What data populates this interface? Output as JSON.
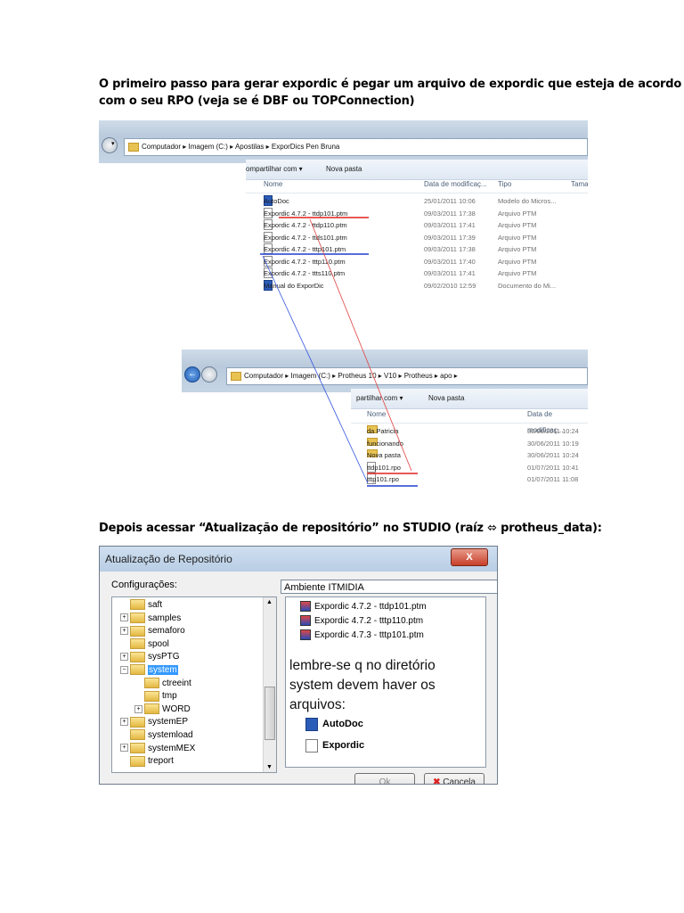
{
  "intro": {
    "line1": "O primeiro passo para gerar expordic é pegar um arquivo de expordic que esteja de acordo",
    "line2": "com o seu RPO (veja se é DBF ou TOPConnection)"
  },
  "explorer1": {
    "path": "Computador  ▸  Imagem (C:)  ▸  Apostilas  ▸  ExporDics Pen Bruna",
    "toolbar_share": "ompartilhar com ▾",
    "toolbar_newfolder": "Nova pasta",
    "cols": {
      "name": "Nome",
      "date": "Data de modificaç...",
      "type": "Tipo",
      "size": "Tama"
    },
    "files": [
      {
        "name": "AutoDoc",
        "date": "25/01/2011 10:06",
        "type": "Modelo do Micros..."
      },
      {
        "name": "Expordic 4.7.2 - ttdp101.ptm",
        "date": "09/03/2011 17:38",
        "type": "Arquivo PTM"
      },
      {
        "name": "Expordic 4.7.2 - ttdp110.ptm",
        "date": "09/03/2011 17:41",
        "type": "Arquivo PTM"
      },
      {
        "name": "Expordic 4.7.2 - ttds101.ptm",
        "date": "09/03/2011 17:39",
        "type": "Arquivo PTM"
      },
      {
        "name": "Expordic 4.7.2 - tttp101.ptm",
        "date": "09/03/2011 17:38",
        "type": "Arquivo PTM"
      },
      {
        "name": "Expordic 4.7.2 - tttp110.ptm",
        "date": "09/03/2011 17:40",
        "type": "Arquivo PTM"
      },
      {
        "name": "Expordic 4.7.2 - ttts110.ptm",
        "date": "09/03/2011 17:41",
        "type": "Arquivo PTM"
      },
      {
        "name": "Manual do ExporDic",
        "date": "09/02/2010 12:59",
        "type": "Documento do Mi..."
      }
    ]
  },
  "explorer2": {
    "path": "Computador  ▸  Imagem (C:)  ▸  Protheus 10  ▸  V10  ▸  Protheus  ▸  apo  ▸",
    "toolbar_share": "partilhar com ▾",
    "toolbar_newfolder": "Nova pasta",
    "cols": {
      "name": "Nome",
      "date": "Data de modificaç..."
    },
    "files": [
      {
        "name": "da Patricia",
        "date": "30/06/2011 10:24"
      },
      {
        "name": "funcionando",
        "date": "30/06/2011 10:19"
      },
      {
        "name": "Nova pasta",
        "date": "30/06/2011 10:24"
      },
      {
        "name": "ttdp101.rpo",
        "date": "01/07/2011 10:41"
      },
      {
        "name": "tttp101.rpo",
        "date": "01/07/2011 11:08"
      }
    ]
  },
  "step2": {
    "text": "Depois acessar “Atualização de repositório” no STUDIO (raíz ⬄ protheus_data):"
  },
  "dialog": {
    "title": "Atualização de Repositório",
    "close": "X",
    "config_label": "Configurações:",
    "config_value": "Ambiente ITMIDIA",
    "tree": [
      "saft",
      "samples",
      "semaforo",
      "spool",
      "sysPTG",
      "system",
      "ctreeint",
      "tmp",
      "WORD",
      "systemEP",
      "systemload",
      "systemMEX",
      "treport"
    ],
    "patches": [
      "Expordic 4.7.2 - ttdp101.ptm",
      "Expordic 4.7.2 - tttp110.ptm",
      "Expordic 4.7.3 - tttp101.ptm"
    ],
    "note": "lembre-se q no diretório system devem haver os arquivos:",
    "note_files": [
      "AutoDoc",
      "Expordic"
    ],
    "ok": "Ok",
    "cancel": "Cancela"
  }
}
